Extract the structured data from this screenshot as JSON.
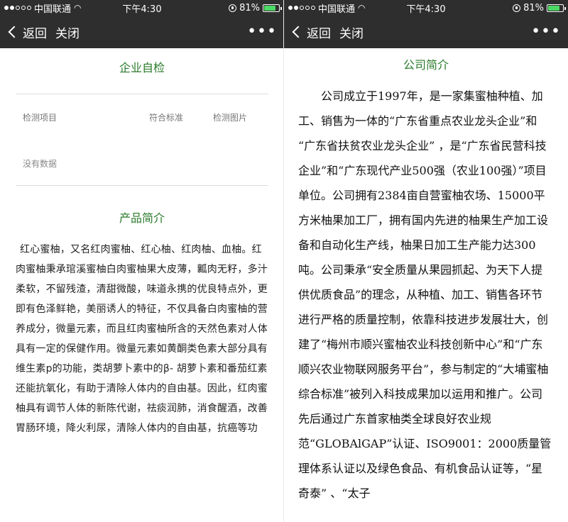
{
  "status": {
    "carrier": "中国联通",
    "time": "下午4:30",
    "battery": "81%",
    "battery_level": 0.81,
    "wifi_icon": "wifi-icon",
    "lock_icon": "orientation-lock-icon"
  },
  "nav": {
    "back_label": "返回",
    "close_label": "关闭",
    "more_label": "•••"
  },
  "left": {
    "section1_title": "企业自检",
    "table_headers": [
      "检测项目",
      "符合标准",
      "检测图片"
    ],
    "no_data": "没有数据",
    "section2_title": "产品简介",
    "product_text": "红心蜜柚，又名红肉蜜柚、红心柚、红肉柚、血柚。红肉蜜柚秉承琯溪蜜柚白肉蜜柚果大皮薄，瓤肉无籽，多汁柔软，不留残渣，清甜微酸，味道永携的优良特点外，更即有色泽鲜艳，美丽诱人的特征，不仅具备白肉蜜柚的营养成分，微量元素，而且红肉蜜柚所含的天然色素对人体具有一定的保健作用。微量元素如黄酮类色素大部分具有维生素p的功能，类胡萝卜素中的β- 胡萝卜素和番茄红素还能抗氧化，有助于清除人体内的自由基。因此，红肉蜜柚具有调节人体的新陈代谢，祛痰润肺，消食醒酒，改善胃肠环境，降火利尿，清除人体内的自由基，抗癌等功"
  },
  "right": {
    "section_title": "公司简介",
    "company_text": "公司成立于1997年，是一家集蜜柚种植、加工、销售为一体的“广东省重点农业龙头企业”和 “广东省扶贫农业龙头企业” ，是“广东省民营科技企业”和“广东现代产业500强（农业100强）”项目单位。公司拥有2384亩自营蜜柚农场、15000平方米柚果加工厂，拥有国内先进的柚果生产加工设备和自动化生产线，柚果日加工生产能力达300吨。公司秉承“安全质量从果园抓起、为天下人提供优质食品”的理念，从种植、加工、销售各环节进行严格的质量控制，依靠科技进步发展壮大，创建了“梅州市顺兴蜜柚农业科技创新中心”和“广东顺兴农业物联网服务平台”，参与制定的“大埔蜜柚综合标准”被列入科技成果加以运用和推广。公司先后通过广东首家柚类全球良好农业规范“GLOBAlGAP”认证、ISO9001：2000质量管理体系认证以及绿色食品、有机食品认证等，“星奇泰” 、“太子"
  }
}
